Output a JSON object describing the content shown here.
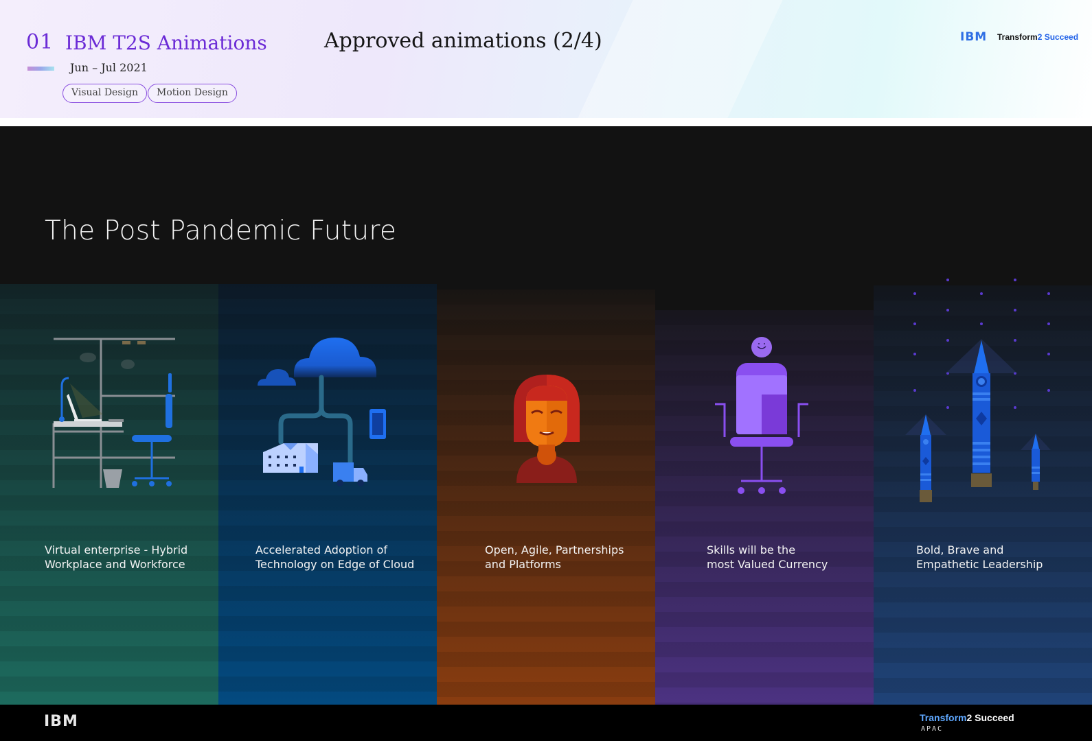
{
  "header": {
    "project_number": "01",
    "project_title": "IBM T2S Animations",
    "date_range": "Jun – Jul 2021",
    "tags": [
      "Visual Design",
      "Motion Design"
    ],
    "slide_title": "Approved animations (2/4)",
    "logo_ibm": "IBM",
    "logo_transform_prefix": "Transform",
    "logo_transform_suffix": "2 Succeed"
  },
  "slide": {
    "heading": "The Post Pandemic Future",
    "columns": [
      {
        "caption": "Virtual enterprise - Hybrid\nWorkplace and Workforce",
        "color_top": "#14272a",
        "color_bottom": "#1d6b5e",
        "icon": "home-office-desk-icon"
      },
      {
        "caption": "Accelerated Adoption of\nTechnology on Edge of Cloud",
        "color_top": "#0d1c2a",
        "color_bottom": "#034a80",
        "icon": "cloud-network-icon"
      },
      {
        "caption": "Open, Agile, Partnerships\nand Platforms",
        "color_top": "#1b1715",
        "color_bottom": "#8a3d10",
        "icon": "person-portrait-icon"
      },
      {
        "caption": "Skills will be the\nmost Valued Currency",
        "color_top": "#1a1820",
        "color_bottom": "#4c3282",
        "icon": "office-chair-icon"
      },
      {
        "caption": "Bold, Brave and\nEmpathetic Leadership",
        "color_top": "#14181f",
        "color_bottom": "#1f4378",
        "icon": "rockets-icon"
      }
    ]
  },
  "footer": {
    "logo_ibm": "IBM",
    "logo_transform_prefix": "Transform",
    "logo_transform_suffix": "2 Succeed",
    "region": "APAC"
  }
}
